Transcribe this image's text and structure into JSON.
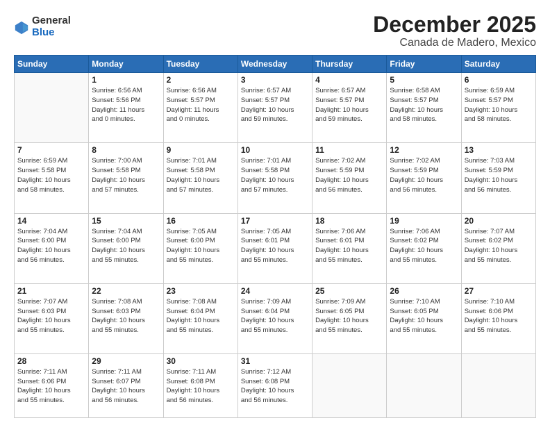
{
  "logo": {
    "general": "General",
    "blue": "Blue"
  },
  "title": "December 2025",
  "subtitle": "Canada de Madero, Mexico",
  "header_days": [
    "Sunday",
    "Monday",
    "Tuesday",
    "Wednesday",
    "Thursday",
    "Friday",
    "Saturday"
  ],
  "weeks": [
    [
      {
        "day": "",
        "info": ""
      },
      {
        "day": "1",
        "info": "Sunrise: 6:56 AM\nSunset: 5:56 PM\nDaylight: 11 hours\nand 0 minutes."
      },
      {
        "day": "2",
        "info": "Sunrise: 6:56 AM\nSunset: 5:57 PM\nDaylight: 11 hours\nand 0 minutes."
      },
      {
        "day": "3",
        "info": "Sunrise: 6:57 AM\nSunset: 5:57 PM\nDaylight: 10 hours\nand 59 minutes."
      },
      {
        "day": "4",
        "info": "Sunrise: 6:57 AM\nSunset: 5:57 PM\nDaylight: 10 hours\nand 59 minutes."
      },
      {
        "day": "5",
        "info": "Sunrise: 6:58 AM\nSunset: 5:57 PM\nDaylight: 10 hours\nand 58 minutes."
      },
      {
        "day": "6",
        "info": "Sunrise: 6:59 AM\nSunset: 5:57 PM\nDaylight: 10 hours\nand 58 minutes."
      }
    ],
    [
      {
        "day": "7",
        "info": "Sunrise: 6:59 AM\nSunset: 5:58 PM\nDaylight: 10 hours\nand 58 minutes."
      },
      {
        "day": "8",
        "info": "Sunrise: 7:00 AM\nSunset: 5:58 PM\nDaylight: 10 hours\nand 57 minutes."
      },
      {
        "day": "9",
        "info": "Sunrise: 7:01 AM\nSunset: 5:58 PM\nDaylight: 10 hours\nand 57 minutes."
      },
      {
        "day": "10",
        "info": "Sunrise: 7:01 AM\nSunset: 5:58 PM\nDaylight: 10 hours\nand 57 minutes."
      },
      {
        "day": "11",
        "info": "Sunrise: 7:02 AM\nSunset: 5:59 PM\nDaylight: 10 hours\nand 56 minutes."
      },
      {
        "day": "12",
        "info": "Sunrise: 7:02 AM\nSunset: 5:59 PM\nDaylight: 10 hours\nand 56 minutes."
      },
      {
        "day": "13",
        "info": "Sunrise: 7:03 AM\nSunset: 5:59 PM\nDaylight: 10 hours\nand 56 minutes."
      }
    ],
    [
      {
        "day": "14",
        "info": "Sunrise: 7:04 AM\nSunset: 6:00 PM\nDaylight: 10 hours\nand 56 minutes."
      },
      {
        "day": "15",
        "info": "Sunrise: 7:04 AM\nSunset: 6:00 PM\nDaylight: 10 hours\nand 55 minutes."
      },
      {
        "day": "16",
        "info": "Sunrise: 7:05 AM\nSunset: 6:00 PM\nDaylight: 10 hours\nand 55 minutes."
      },
      {
        "day": "17",
        "info": "Sunrise: 7:05 AM\nSunset: 6:01 PM\nDaylight: 10 hours\nand 55 minutes."
      },
      {
        "day": "18",
        "info": "Sunrise: 7:06 AM\nSunset: 6:01 PM\nDaylight: 10 hours\nand 55 minutes."
      },
      {
        "day": "19",
        "info": "Sunrise: 7:06 AM\nSunset: 6:02 PM\nDaylight: 10 hours\nand 55 minutes."
      },
      {
        "day": "20",
        "info": "Sunrise: 7:07 AM\nSunset: 6:02 PM\nDaylight: 10 hours\nand 55 minutes."
      }
    ],
    [
      {
        "day": "21",
        "info": "Sunrise: 7:07 AM\nSunset: 6:03 PM\nDaylight: 10 hours\nand 55 minutes."
      },
      {
        "day": "22",
        "info": "Sunrise: 7:08 AM\nSunset: 6:03 PM\nDaylight: 10 hours\nand 55 minutes."
      },
      {
        "day": "23",
        "info": "Sunrise: 7:08 AM\nSunset: 6:04 PM\nDaylight: 10 hours\nand 55 minutes."
      },
      {
        "day": "24",
        "info": "Sunrise: 7:09 AM\nSunset: 6:04 PM\nDaylight: 10 hours\nand 55 minutes."
      },
      {
        "day": "25",
        "info": "Sunrise: 7:09 AM\nSunset: 6:05 PM\nDaylight: 10 hours\nand 55 minutes."
      },
      {
        "day": "26",
        "info": "Sunrise: 7:10 AM\nSunset: 6:05 PM\nDaylight: 10 hours\nand 55 minutes."
      },
      {
        "day": "27",
        "info": "Sunrise: 7:10 AM\nSunset: 6:06 PM\nDaylight: 10 hours\nand 55 minutes."
      }
    ],
    [
      {
        "day": "28",
        "info": "Sunrise: 7:11 AM\nSunset: 6:06 PM\nDaylight: 10 hours\nand 55 minutes."
      },
      {
        "day": "29",
        "info": "Sunrise: 7:11 AM\nSunset: 6:07 PM\nDaylight: 10 hours\nand 56 minutes."
      },
      {
        "day": "30",
        "info": "Sunrise: 7:11 AM\nSunset: 6:08 PM\nDaylight: 10 hours\nand 56 minutes."
      },
      {
        "day": "31",
        "info": "Sunrise: 7:12 AM\nSunset: 6:08 PM\nDaylight: 10 hours\nand 56 minutes."
      },
      {
        "day": "",
        "info": ""
      },
      {
        "day": "",
        "info": ""
      },
      {
        "day": "",
        "info": ""
      }
    ]
  ]
}
